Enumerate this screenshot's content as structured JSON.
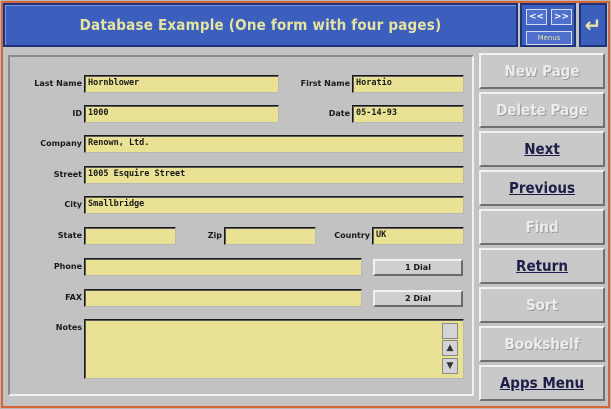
{
  "window": {
    "title": "Database Example (One form with four pages)",
    "nav_prev": "<<",
    "nav_next": ">>",
    "menus_label": "Menus",
    "return_glyph": "↵"
  },
  "form": {
    "last_name": {
      "label": "Last Name",
      "value": "Hornblower"
    },
    "first_name": {
      "label": "First Name",
      "value": "Horatio"
    },
    "id": {
      "label": "ID",
      "value": "1000"
    },
    "date": {
      "label": "Date",
      "value": "05-14-93"
    },
    "company": {
      "label": "Company",
      "value": "Renown, Ltd."
    },
    "street": {
      "label": "Street",
      "value": "1005 Esquire Street"
    },
    "city": {
      "label": "City",
      "value": "Smallbridge"
    },
    "state": {
      "label": "State",
      "value": ""
    },
    "zip": {
      "label": "Zip",
      "value": ""
    },
    "country": {
      "label": "Country",
      "value": "UK"
    },
    "phone": {
      "label": "Phone",
      "value": ""
    },
    "fax": {
      "label": "FAX",
      "value": ""
    },
    "notes": {
      "label": "Notes",
      "value": ""
    },
    "dial1": "1 Dial",
    "dial2": "2 Dial",
    "scroll_up": "▲",
    "scroll_down": "▼"
  },
  "sidebar": {
    "new_page": "New Page",
    "delete_page": "Delete Page",
    "next": "Next",
    "previous": "Previous",
    "find": "Find",
    "return": "Return",
    "sort": "Sort",
    "bookshelf": "Bookshelf",
    "apps_menu": "Apps Menu"
  }
}
